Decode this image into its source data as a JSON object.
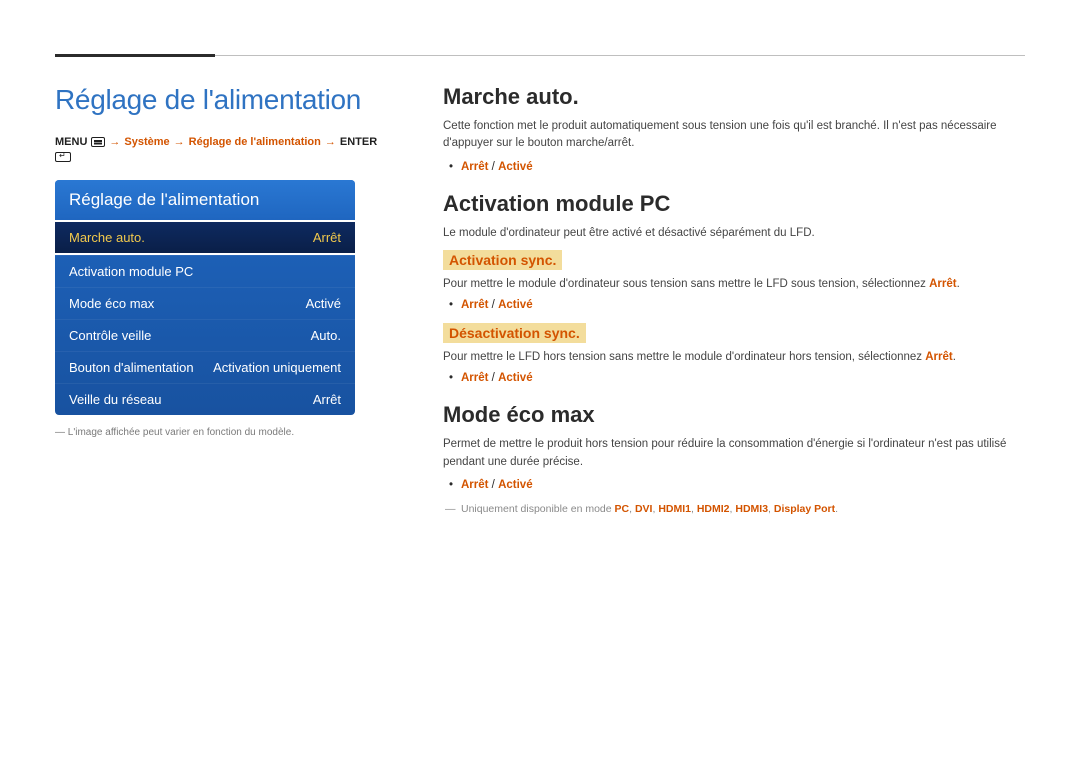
{
  "left": {
    "page_title": "Réglage de l'alimentation",
    "breadcrumb": {
      "menu": "MENU",
      "arrow": "→",
      "system": "Système",
      "setting": "Réglage de l'alimentation",
      "enter": "ENTER"
    },
    "panel": {
      "title": "Réglage de l'alimentation",
      "rows": [
        {
          "label": "Marche auto.",
          "value": "Arrêt",
          "selected": true
        },
        {
          "label": "Activation module PC",
          "value": "",
          "selected": false
        },
        {
          "label": "Mode éco max",
          "value": "Activé",
          "selected": false
        },
        {
          "label": "Contrôle veille",
          "value": "Auto.",
          "selected": false
        },
        {
          "label": "Bouton d'alimentation",
          "value": "Activation uniquement",
          "selected": false
        },
        {
          "label": "Veille du réseau",
          "value": "Arrêt",
          "selected": false
        }
      ]
    },
    "footnote": "L'image affichée peut varier en fonction du modèle."
  },
  "right": {
    "marche_auto": {
      "title": "Marche auto.",
      "body": "Cette fonction met le produit automatiquement sous tension une fois qu'il est branché. Il n'est pas nécessaire d'appuyer sur le bouton marche/arrêt.",
      "opt1": "Arrêt",
      "sep": " / ",
      "opt2": "Activé"
    },
    "activation_pc": {
      "title": "Activation module PC",
      "body": "Le module d'ordinateur peut être activé et désactivé séparément du LFD.",
      "sync_on": {
        "title": "Activation sync.",
        "body_a": "Pour mettre le module d'ordinateur sous tension sans mettre le LFD sous tension, sélectionnez ",
        "body_b": "Arrêt",
        "body_c": ".",
        "opt1": "Arrêt",
        "sep": " / ",
        "opt2": "Activé"
      },
      "sync_off": {
        "title": "Désactivation sync.",
        "body_a": "Pour mettre le LFD hors tension sans mettre le module d'ordinateur hors tension, sélectionnez ",
        "body_b": "Arrêt",
        "body_c": ".",
        "opt1": "Arrêt",
        "sep": " / ",
        "opt2": "Activé"
      }
    },
    "eco": {
      "title": "Mode éco max",
      "body": "Permet de mettre le produit hors tension pour réduire la consommation d'énergie si l'ordinateur n'est pas utilisé pendant une durée précise.",
      "opt1": "Arrêt",
      "sep": " / ",
      "opt2": "Activé",
      "note_a": "Uniquement disponible en mode ",
      "modes": [
        "PC",
        "DVI",
        "HDMI1",
        "HDMI2",
        "HDMI3",
        "Display Port"
      ],
      "note_b": "."
    }
  }
}
